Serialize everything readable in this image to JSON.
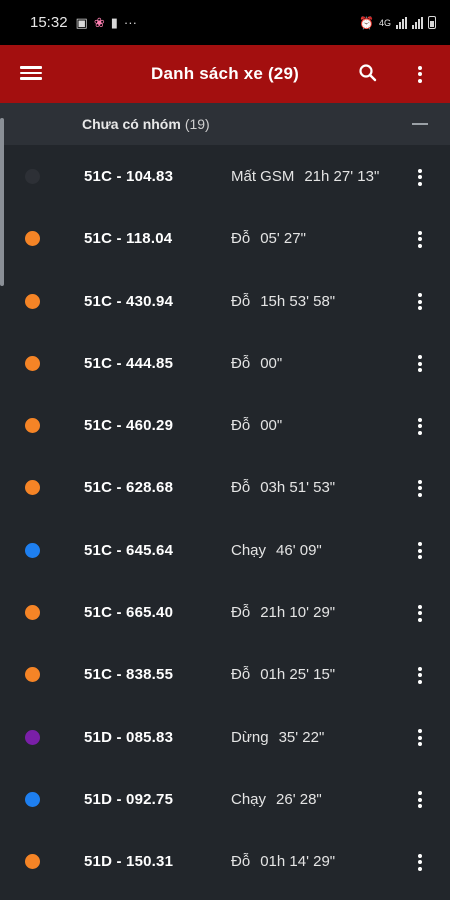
{
  "status_bar": {
    "time": "15:32",
    "icons": [
      "image-icon",
      "notification-badge-icon",
      "message-icon",
      "more-dots-icon"
    ],
    "right_icons": [
      "alarm-icon",
      "data-4g-icon",
      "wifi-signal-icon",
      "cell-signal-icon",
      "battery-icon"
    ]
  },
  "appbar": {
    "title": "Danh sách xe (29)",
    "color": "#a30f0f"
  },
  "group": {
    "name": "Chưa có nhóm",
    "count": "(19)"
  },
  "status_colors": {
    "lost_gsm": "#2d3036",
    "parked": "#f58426",
    "running": "#1e7ff0",
    "stopped": "#7a1fa8"
  },
  "vehicles": [
    {
      "plate": "51C - 104.83",
      "status": "Mất GSM",
      "duration": "21h 27' 13\"",
      "color": "#2d3036"
    },
    {
      "plate": "51C - 118.04",
      "status": "Đỗ",
      "duration": "05' 27\"",
      "color": "#f58426"
    },
    {
      "plate": "51C - 430.94",
      "status": "Đỗ",
      "duration": "15h 53' 58\"",
      "color": "#f58426"
    },
    {
      "plate": "51C - 444.85",
      "status": "Đỗ",
      "duration": "00\"",
      "color": "#f58426"
    },
    {
      "plate": "51C - 460.29",
      "status": "Đỗ",
      "duration": "00\"",
      "color": "#f58426"
    },
    {
      "plate": "51C - 628.68",
      "status": "Đỗ",
      "duration": "03h 51' 53\"",
      "color": "#f58426"
    },
    {
      "plate": "51C - 645.64",
      "status": "Chạy",
      "duration": "46' 09\"",
      "color": "#1e7ff0"
    },
    {
      "plate": "51C - 665.40",
      "status": "Đỗ",
      "duration": "21h 10' 29\"",
      "color": "#f58426"
    },
    {
      "plate": "51C - 838.55",
      "status": "Đỗ",
      "duration": "01h 25' 15\"",
      "color": "#f58426"
    },
    {
      "plate": "51D - 085.83",
      "status": "Dừng",
      "duration": "35' 22\"",
      "color": "#7a1fa8"
    },
    {
      "plate": "51D - 092.75",
      "status": "Chạy",
      "duration": "26' 28\"",
      "color": "#1e7ff0"
    },
    {
      "plate": "51D - 150.31",
      "status": "Đỗ",
      "duration": "01h 14' 29\"",
      "color": "#f58426"
    }
  ]
}
